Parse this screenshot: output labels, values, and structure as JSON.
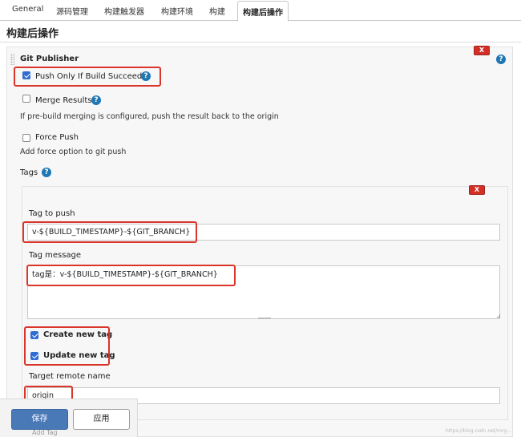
{
  "tabs": [
    "General",
    "源码管理",
    "构建触发器",
    "构建环境",
    "构建",
    "构建后操作"
  ],
  "section_title": "构建后操作",
  "git_publisher": {
    "title": "Git Publisher",
    "delete_label": "X",
    "push_only_label": "Push Only If Build Succeeds",
    "push_only_checked": true,
    "merge_results_label": "Merge Results",
    "merge_results_checked": false,
    "merge_desc": "If pre-build merging is configured, push the result back to the origin",
    "force_push_label": "Force Push",
    "force_push_checked": false,
    "force_push_desc": "Add force option to git push",
    "tags_label": "Tags"
  },
  "tag": {
    "delete_label": "X",
    "tag_to_push_label": "Tag to push",
    "tag_to_push_value": "v-${BUILD_TIMESTAMP}-${GIT_BRANCH}",
    "tag_message_label": "Tag message",
    "tag_message_value": "tag是：v-${BUILD_TIMESTAMP}-${GIT_BRANCH}",
    "create_new_tag_label": "Create new tag",
    "create_new_tag_checked": true,
    "update_new_tag_label": "Update new tag",
    "update_new_tag_checked": true,
    "target_remote_label": "Target remote name",
    "target_remote_value": "origin"
  },
  "help_glyph": "?",
  "footer": {
    "save_label": "保存",
    "apply_label": "应用",
    "add_tag_label": "Add Tag"
  },
  "watermark": "https://blog.csdn.net/mrg...",
  "colors": {
    "primary": "#4a79b8",
    "danger": "#d22f27",
    "help": "#1f77b4",
    "highlight": "#d9352a"
  }
}
